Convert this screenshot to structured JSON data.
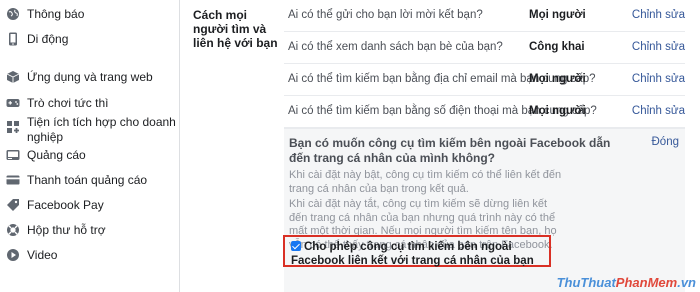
{
  "sidebar": {
    "items": [
      {
        "label": "Thông báo",
        "icon": "globe-icon"
      },
      {
        "label": "Di động",
        "icon": "mobile-icon"
      },
      {
        "label": "Ứng dụng và trang web",
        "icon": "apps-cube-icon"
      },
      {
        "label": "Trò chơi tức thì",
        "icon": "game-controller-icon"
      },
      {
        "label": "Tiện ích tích hợp cho doanh nghiệp",
        "icon": "business-integration-icon"
      },
      {
        "label": "Quảng cáo",
        "icon": "ads-icon"
      },
      {
        "label": "Thanh toán quảng cáo",
        "icon": "credit-card-icon"
      },
      {
        "label": "Facebook Pay",
        "icon": "tag-icon"
      },
      {
        "label": "Hộp thư hỗ trợ",
        "icon": "lifebuoy-icon"
      },
      {
        "label": "Video",
        "icon": "video-icon"
      }
    ]
  },
  "main": {
    "section_title": "Cách mọi người tìm và liên hệ với bạn",
    "rows": [
      {
        "question": "Ai có thể gửi cho bạn lời mời kết bạn?",
        "value": "Mọi người",
        "edit": "Chỉnh sửa"
      },
      {
        "question": "Ai có thể xem danh sách bạn bè của bạn?",
        "value": "Công khai",
        "edit": "Chỉnh sửa"
      },
      {
        "question": "Ai có thể tìm kiếm bạn bằng địa chỉ email mà bạn cung cấp?",
        "value": "Mọi người",
        "edit": "Chỉnh sửa"
      },
      {
        "question": "Ai có thể tìm kiếm bạn bằng số điện thoại mà bạn cung cấp?",
        "value": "Mọi người",
        "edit": "Chỉnh sửa"
      }
    ],
    "panel": {
      "title": "Bạn có muốn công cụ tìm kiếm bên ngoài Facebook dẫn đến trang cá nhân của mình không?",
      "close": "Đóng",
      "paragraph_1": "Khi cài đặt này bật, công cụ tìm kiếm có thể liên kết đến trang cá nhân của bạn trong kết quả.",
      "paragraph_2": "Khi cài đặt này tắt, công cụ tìm kiếm sẽ dừng liên kết đến trang cá nhân của bạn nhưng quá trình này có thể mất một thời gian. Nếu mọi người tìm kiếm tên bạn, họ vẫn có thể thấy trang cá nhân của bạn trên Facebook.",
      "checkbox_label": "Cho phép công cụ tìm kiếm bên ngoài Facebook liên kết với trang cá nhân của bạn",
      "checkbox_checked": true
    }
  },
  "watermark": {
    "part1": "ThuThuat",
    "part2": "PhanMem",
    "part3": ".vn"
  },
  "colors": {
    "link": "#365899",
    "highlight_border": "#d93025",
    "checkbox": "#1877f2"
  }
}
